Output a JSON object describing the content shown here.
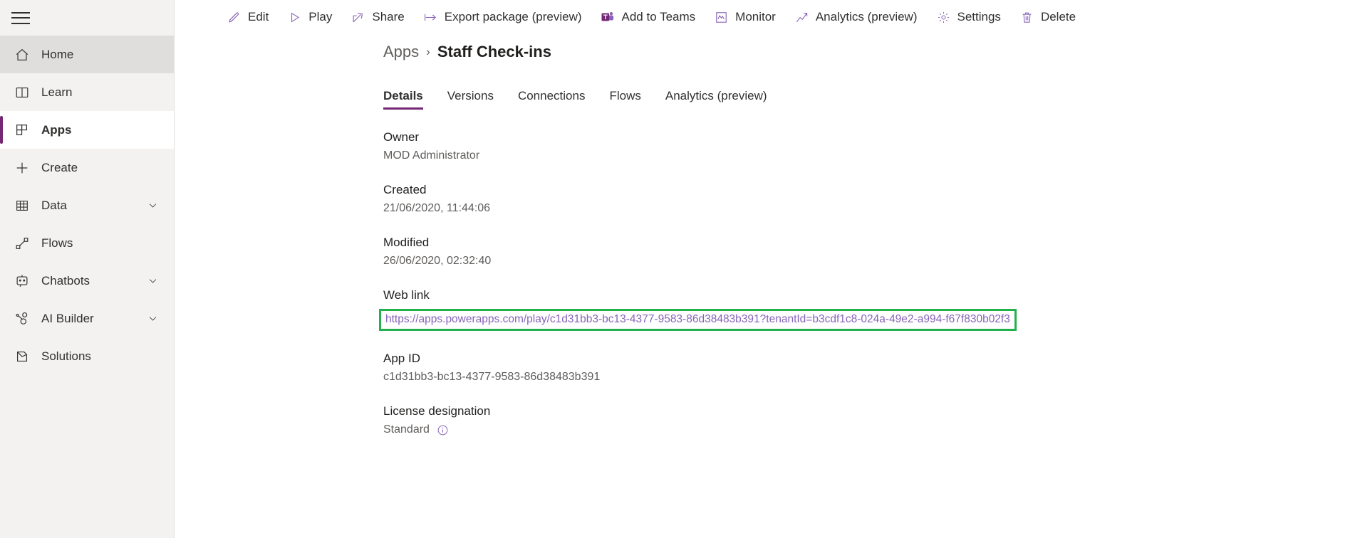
{
  "sidebar": {
    "hamburger_name": "hamburger-menu",
    "items": [
      {
        "label": "Home",
        "icon": "home-icon",
        "state": "hover",
        "chevron": false
      },
      {
        "label": "Learn",
        "icon": "book-icon",
        "state": "normal",
        "chevron": false
      },
      {
        "label": "Apps",
        "icon": "apps-grid-icon",
        "state": "selected",
        "chevron": false
      },
      {
        "label": "Create",
        "icon": "plus-icon",
        "state": "normal",
        "chevron": false
      },
      {
        "label": "Data",
        "icon": "table-icon",
        "state": "normal",
        "chevron": true
      },
      {
        "label": "Flows",
        "icon": "flow-icon",
        "state": "normal",
        "chevron": false
      },
      {
        "label": "Chatbots",
        "icon": "chatbot-icon",
        "state": "normal",
        "chevron": true
      },
      {
        "label": "AI Builder",
        "icon": "ai-builder-icon",
        "state": "normal",
        "chevron": true
      },
      {
        "label": "Solutions",
        "icon": "solutions-icon",
        "state": "normal",
        "chevron": false
      }
    ]
  },
  "toolbar": {
    "items": [
      {
        "label": "Edit",
        "icon": "pencil-icon"
      },
      {
        "label": "Play",
        "icon": "play-triangle-icon"
      },
      {
        "label": "Share",
        "icon": "share-arrow-icon"
      },
      {
        "label": "Export package (preview)",
        "icon": "export-arrow-icon"
      },
      {
        "label": "Add to Teams",
        "icon": "teams-icon"
      },
      {
        "label": "Monitor",
        "icon": "monitor-chart-icon"
      },
      {
        "label": "Analytics (preview)",
        "icon": "analytics-line-icon"
      },
      {
        "label": "Settings",
        "icon": "gear-icon"
      },
      {
        "label": "Delete",
        "icon": "trash-icon"
      }
    ]
  },
  "breadcrumb": {
    "parent": "Apps",
    "separator": "›",
    "current": "Staff Check-ins"
  },
  "tabs": [
    {
      "label": "Details",
      "active": true
    },
    {
      "label": "Versions",
      "active": false
    },
    {
      "label": "Connections",
      "active": false
    },
    {
      "label": "Flows",
      "active": false
    },
    {
      "label": "Analytics (preview)",
      "active": false
    }
  ],
  "details": {
    "owner": {
      "label": "Owner",
      "value": "MOD Administrator"
    },
    "created": {
      "label": "Created",
      "value": "21/06/2020, 11:44:06"
    },
    "modified": {
      "label": "Modified",
      "value": "26/06/2020, 02:32:40"
    },
    "web_link": {
      "label": "Web link",
      "value": "https://apps.powerapps.com/play/c1d31bb3-bc13-4377-9583-86d38483b391?tenantId=b3cdf1c8-024a-49e2-a994-f67f830b02f3",
      "highlight_color": "#22b14c",
      "link_color": "#8764b8"
    },
    "app_id": {
      "label": "App ID",
      "value": "c1d31bb3-bc13-4377-9583-86d38483b391"
    },
    "license": {
      "label": "License designation",
      "value": "Standard",
      "info_icon": "info-circle-icon"
    }
  },
  "colors": {
    "accent": "#742774",
    "sidebar_bg": "#f3f2f1",
    "sidebar_hover": "#dfdedd",
    "icon_purple": "#8764b8",
    "text_primary": "#201f1e",
    "text_secondary": "#605e5c"
  }
}
